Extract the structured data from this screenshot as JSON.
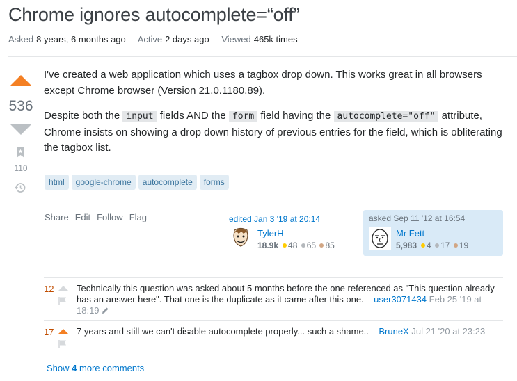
{
  "question": {
    "title": "Chrome ignores autocomplete=“off”",
    "meta": {
      "asked_label": "Asked",
      "asked_value": "8 years, 6 months ago",
      "active_label": "Active",
      "active_value": "2 days ago",
      "viewed_label": "Viewed",
      "viewed_value": "465k times"
    },
    "votes": "536",
    "bookmarks": "110",
    "body": {
      "p1": "I've created a web application which uses a tagbox drop down. This works great in all browsers except Chrome browser (Version 21.0.1180.89).",
      "p2_a": "Despite both the ",
      "p2_code1": "input",
      "p2_b": " fields AND the ",
      "p2_code2": "form",
      "p2_c": " field having the ",
      "p2_code3": "autocomplete=\"off\"",
      "p2_d": " attribute, Chrome insists on showing a drop down history of previous entries for the field, which is obliterating the tagbox list."
    },
    "tags": [
      "html",
      "google-chrome",
      "autocomplete",
      "forms"
    ],
    "actions": [
      "Share",
      "Edit",
      "Follow",
      "Flag"
    ],
    "edited": {
      "when": "edited Jan 3 '19 at 20:14",
      "user": "TylerH",
      "rep": "18.9k",
      "gold": "48",
      "silver": "65",
      "bronze": "85"
    },
    "asked": {
      "when": "asked Sep 11 '12 at 16:54",
      "user": "Mr Fett",
      "rep": "5,983",
      "gold": "4",
      "silver": "17",
      "bronze": "19"
    }
  },
  "comments": [
    {
      "score": "12",
      "text": "Technically this question was asked about 5 months before the one referenced as \"This question already has an answer here\". That one is the duplicate as it came after this one. – ",
      "user": "user3071434",
      "date": "Feb 25 '19 at 18:19"
    },
    {
      "score": "17",
      "text": "7 years and still we can't disable autocomplete properly... such a shame.. – ",
      "user": "BruneX",
      "date": "Jul 21 '20 at 23:23"
    }
  ],
  "show_more": {
    "prefix": "Show ",
    "count": "4",
    "suffix": " more comments"
  },
  "colors": {
    "accent_orange": "#f48024",
    "link_blue": "#0077cc",
    "tag_bg": "#e1ecf4",
    "owner_bg": "#d9eaf7"
  }
}
